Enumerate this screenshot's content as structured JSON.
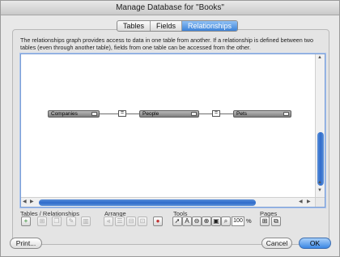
{
  "window": {
    "title": "Manage Database for \"Books\""
  },
  "tabs": [
    {
      "label": "Tables",
      "active": false
    },
    {
      "label": "Fields",
      "active": false
    },
    {
      "label": "Relationships",
      "active": true
    }
  ],
  "description": "The relationships graph provides access to data in one table from another. If a relationship is defined between two tables (even through another table), fields from one table can be accessed from the other.",
  "graph": {
    "tables": [
      {
        "name": "Companies"
      },
      {
        "name": "People"
      },
      {
        "name": "Pets"
      }
    ],
    "relationship_symbol": "="
  },
  "toolbar": {
    "tables_relationships_label": "Tables / Relationships",
    "arrange_label": "Arrange",
    "tools_label": "Tools",
    "pages_label": "Pages",
    "zoom_value": "100",
    "zoom_unit": "%"
  },
  "buttons": {
    "print": "Print...",
    "cancel": "Cancel",
    "ok": "OK"
  },
  "colors": {
    "accent": "#3d83d8",
    "table_header": "#9a9a9a"
  }
}
